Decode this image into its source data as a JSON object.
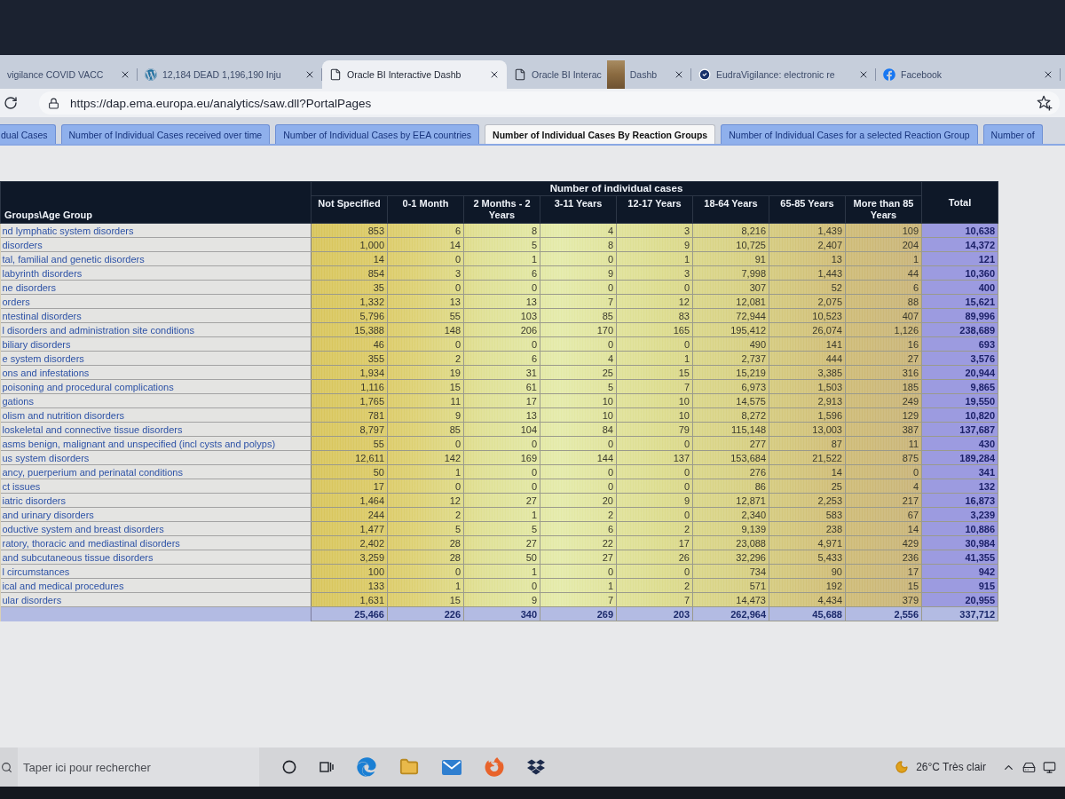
{
  "browser": {
    "tabs": [
      {
        "kind": "plain",
        "title": "vigilance COVID VACC",
        "selected": false
      },
      {
        "kind": "wordpress",
        "title": "12,184 DEAD 1,196,190 Inju",
        "selected": false
      },
      {
        "kind": "page",
        "title": "Oracle BI Interactive Dashb",
        "selected": true
      },
      {
        "kind": "page",
        "title": "Oracle BI Interac",
        "title_tail": "Dashb",
        "selected": false
      },
      {
        "kind": "verified",
        "title": "EudraVigilance: electronic re",
        "selected": false
      },
      {
        "kind": "facebook",
        "title": "Facebook",
        "selected": false
      }
    ],
    "url": "https://dap.ema.europa.eu/analytics/saw.dll?PortalPages"
  },
  "dashboard_tabs": [
    {
      "label": "dual Cases",
      "selected": false
    },
    {
      "label": "Number of Individual Cases received over time",
      "selected": false
    },
    {
      "label": "Number of Individual Cases by EEA countries",
      "selected": false
    },
    {
      "label": "Number of Individual Cases By Reaction Groups",
      "selected": true
    },
    {
      "label": "Number of Individual Cases for a selected Reaction Group",
      "selected": false
    },
    {
      "label": "Number of",
      "selected": false
    }
  ],
  "table": {
    "row_header": "Groups\\Age Group",
    "group_header": "Number of individual cases",
    "columns": [
      {
        "label": "Not Specified",
        "kind": "age"
      },
      {
        "label": "0-1 Month",
        "kind": "age"
      },
      {
        "label": "2 Months - 2 Years",
        "kind": "age"
      },
      {
        "label": "3-11 Years",
        "kind": "age"
      },
      {
        "label": "12-17 Years",
        "kind": "age"
      },
      {
        "label": "18-64 Years",
        "kind": "age"
      },
      {
        "label": "65-85 Years",
        "kind": "age"
      },
      {
        "label": "More than 85 Years",
        "kind": "age"
      },
      {
        "label": "Total",
        "kind": "total"
      }
    ],
    "rows": [
      {
        "kind": "group",
        "label": "nd lymphatic system disorders",
        "values": [
          "853",
          "6",
          "8",
          "4",
          "3",
          "8,216",
          "1,439",
          "109",
          "10,638"
        ]
      },
      {
        "kind": "group",
        "label": "disorders",
        "values": [
          "1,000",
          "14",
          "5",
          "8",
          "9",
          "10,725",
          "2,407",
          "204",
          "14,372"
        ]
      },
      {
        "kind": "group",
        "label": "tal, familial and genetic disorders",
        "values": [
          "14",
          "0",
          "1",
          "0",
          "1",
          "91",
          "13",
          "1",
          "121"
        ]
      },
      {
        "kind": "group",
        "label": "labyrinth disorders",
        "values": [
          "854",
          "3",
          "6",
          "9",
          "3",
          "7,998",
          "1,443",
          "44",
          "10,360"
        ]
      },
      {
        "kind": "group",
        "label": "ne disorders",
        "values": [
          "35",
          "0",
          "0",
          "0",
          "0",
          "307",
          "52",
          "6",
          "400"
        ]
      },
      {
        "kind": "group",
        "label": "orders",
        "values": [
          "1,332",
          "13",
          "13",
          "7",
          "12",
          "12,081",
          "2,075",
          "88",
          "15,621"
        ]
      },
      {
        "kind": "group",
        "label": "ntestinal disorders",
        "values": [
          "5,796",
          "55",
          "103",
          "85",
          "83",
          "72,944",
          "10,523",
          "407",
          "89,996"
        ]
      },
      {
        "kind": "group",
        "label": "l disorders and administration site conditions",
        "values": [
          "15,388",
          "148",
          "206",
          "170",
          "165",
          "195,412",
          "26,074",
          "1,126",
          "238,689"
        ]
      },
      {
        "kind": "group",
        "label": "biliary disorders",
        "values": [
          "46",
          "0",
          "0",
          "0",
          "0",
          "490",
          "141",
          "16",
          "693"
        ]
      },
      {
        "kind": "group",
        "label": "e system disorders",
        "values": [
          "355",
          "2",
          "6",
          "4",
          "1",
          "2,737",
          "444",
          "27",
          "3,576"
        ]
      },
      {
        "kind": "group",
        "label": "ons and infestations",
        "values": [
          "1,934",
          "19",
          "31",
          "25",
          "15",
          "15,219",
          "3,385",
          "316",
          "20,944"
        ]
      },
      {
        "kind": "group",
        "label": "poisoning and procedural complications",
        "values": [
          "1,116",
          "15",
          "61",
          "5",
          "7",
          "6,973",
          "1,503",
          "185",
          "9,865"
        ]
      },
      {
        "kind": "group",
        "label": "gations",
        "values": [
          "1,765",
          "11",
          "17",
          "10",
          "10",
          "14,575",
          "2,913",
          "249",
          "19,550"
        ]
      },
      {
        "kind": "group",
        "label": "olism and nutrition disorders",
        "values": [
          "781",
          "9",
          "13",
          "10",
          "10",
          "8,272",
          "1,596",
          "129",
          "10,820"
        ]
      },
      {
        "kind": "group",
        "label": "loskeletal and connective tissue disorders",
        "values": [
          "8,797",
          "85",
          "104",
          "84",
          "79",
          "115,148",
          "13,003",
          "387",
          "137,687"
        ]
      },
      {
        "kind": "group",
        "label": "asms benign, malignant and unspecified (incl cysts and polyps)",
        "values": [
          "55",
          "0",
          "0",
          "0",
          "0",
          "277",
          "87",
          "11",
          "430"
        ]
      },
      {
        "kind": "group",
        "label": "us system disorders",
        "values": [
          "12,611",
          "142",
          "169",
          "144",
          "137",
          "153,684",
          "21,522",
          "875",
          "189,284"
        ]
      },
      {
        "kind": "group",
        "label": "ancy, puerperium and perinatal conditions",
        "values": [
          "50",
          "1",
          "0",
          "0",
          "0",
          "276",
          "14",
          "0",
          "341"
        ]
      },
      {
        "kind": "group",
        "label": "ct issues",
        "values": [
          "17",
          "0",
          "0",
          "0",
          "0",
          "86",
          "25",
          "4",
          "132"
        ]
      },
      {
        "kind": "group",
        "label": "iatric disorders",
        "values": [
          "1,464",
          "12",
          "27",
          "20",
          "9",
          "12,871",
          "2,253",
          "217",
          "16,873"
        ]
      },
      {
        "kind": "group",
        "label": "and urinary disorders",
        "values": [
          "244",
          "2",
          "1",
          "2",
          "0",
          "2,340",
          "583",
          "67",
          "3,239"
        ]
      },
      {
        "kind": "group",
        "label": "oductive system and breast disorders",
        "values": [
          "1,477",
          "5",
          "5",
          "6",
          "2",
          "9,139",
          "238",
          "14",
          "10,886"
        ]
      },
      {
        "kind": "group",
        "label": "ratory, thoracic and mediastinal disorders",
        "values": [
          "2,402",
          "28",
          "27",
          "22",
          "17",
          "23,088",
          "4,971",
          "429",
          "30,984"
        ]
      },
      {
        "kind": "group",
        "label": "and subcutaneous tissue disorders",
        "values": [
          "3,259",
          "28",
          "50",
          "27",
          "26",
          "32,296",
          "5,433",
          "236",
          "41,355"
        ]
      },
      {
        "kind": "group",
        "label": "l circumstances",
        "values": [
          "100",
          "0",
          "1",
          "0",
          "0",
          "734",
          "90",
          "17",
          "942"
        ]
      },
      {
        "kind": "group",
        "label": "ical and medical procedures",
        "values": [
          "133",
          "1",
          "0",
          "1",
          "2",
          "571",
          "192",
          "15",
          "915"
        ]
      },
      {
        "kind": "group",
        "label": "ular disorders",
        "values": [
          "1,631",
          "15",
          "9",
          "7",
          "7",
          "14,473",
          "4,434",
          "379",
          "20,955"
        ]
      },
      {
        "kind": "total",
        "values": [
          "25,466",
          "226",
          "340",
          "269",
          "203",
          "262,964",
          "45,688",
          "2,556",
          "337,712"
        ]
      }
    ]
  },
  "taskbar": {
    "search": {
      "placeholder": "Taper ici pour rechercher"
    },
    "apps": [
      {
        "kind": "cortana"
      },
      {
        "kind": "task_view"
      },
      {
        "kind": "edge"
      },
      {
        "kind": "explorer"
      },
      {
        "kind": "mail"
      },
      {
        "kind": "firefox"
      },
      {
        "kind": "dropbox"
      }
    ],
    "weather": {
      "temperature": "26°C",
      "condition": "Très clair"
    }
  }
}
